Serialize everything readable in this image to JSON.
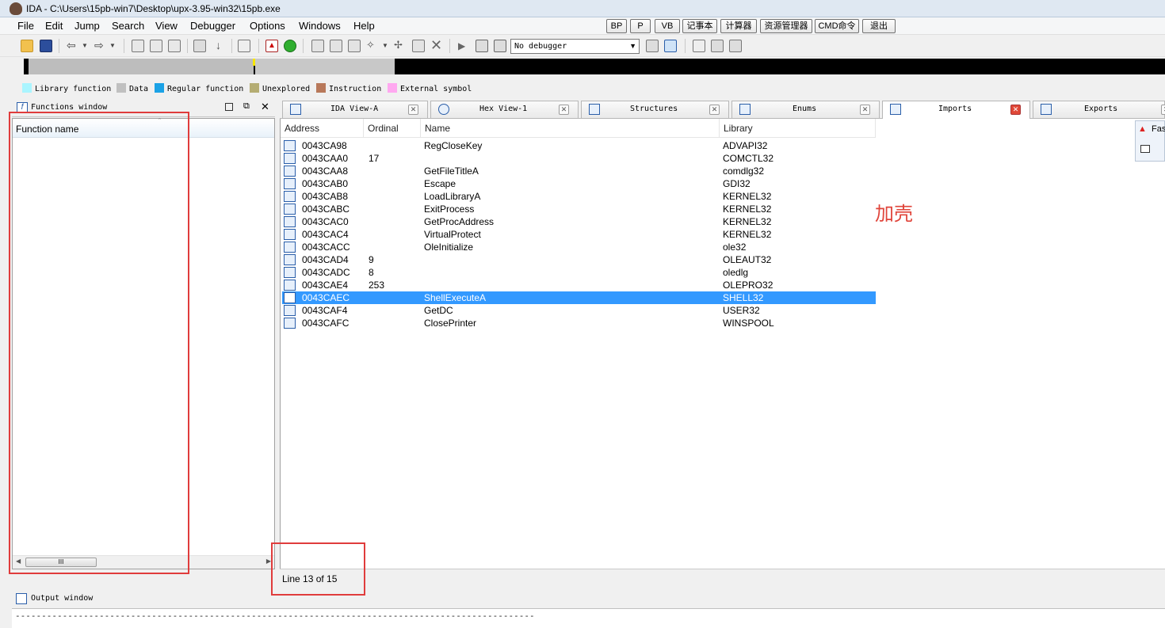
{
  "window": {
    "title": "IDA - C:\\Users\\15pb-win7\\Desktop\\upx-3.95-win32\\15pb.exe"
  },
  "menu": [
    "File",
    "Edit",
    "Jump",
    "Search",
    "View",
    "Debugger",
    "Options",
    "Windows",
    "Help"
  ],
  "quick_buttons": [
    "BP",
    "P",
    "VB",
    "记事本",
    "计算器",
    "资源管理器",
    "CMD命令",
    "退出"
  ],
  "debugger_select": {
    "value": "No debugger"
  },
  "legend": [
    {
      "label": "Library function",
      "color": "#aaf5ff"
    },
    {
      "label": "Data",
      "color": "#c0c0c0"
    },
    {
      "label": "Regular function",
      "color": "#1ba2e6"
    },
    {
      "label": "Unexplored",
      "color": "#b5ad73"
    },
    {
      "label": "Instruction",
      "color": "#b8785a"
    },
    {
      "label": "External symbol",
      "color": "#ffa8f0"
    }
  ],
  "functions_window": {
    "title": "Functions window",
    "column": "Function name",
    "scroll_grip": "III"
  },
  "tabs": [
    {
      "label": "IDA View-A"
    },
    {
      "label": "Hex View-1"
    },
    {
      "label": "Structures"
    },
    {
      "label": "Enums"
    },
    {
      "label": "Imports",
      "active": true
    },
    {
      "label": "Exports"
    }
  ],
  "imports": {
    "columns": [
      "Address",
      "Ordinal",
      "Name",
      "Library"
    ],
    "rows": [
      {
        "address": "0043CA98",
        "ordinal": "",
        "name": "RegCloseKey",
        "library": "ADVAPI32"
      },
      {
        "address": "0043CAA0",
        "ordinal": "17",
        "name": "",
        "library": "COMCTL32"
      },
      {
        "address": "0043CAA8",
        "ordinal": "",
        "name": "GetFileTitleA",
        "library": "comdlg32"
      },
      {
        "address": "0043CAB0",
        "ordinal": "",
        "name": "Escape",
        "library": "GDI32"
      },
      {
        "address": "0043CAB8",
        "ordinal": "",
        "name": "LoadLibraryA",
        "library": "KERNEL32"
      },
      {
        "address": "0043CABC",
        "ordinal": "",
        "name": "ExitProcess",
        "library": "KERNEL32"
      },
      {
        "address": "0043CAC0",
        "ordinal": "",
        "name": "GetProcAddress",
        "library": "KERNEL32"
      },
      {
        "address": "0043CAC4",
        "ordinal": "",
        "name": "VirtualProtect",
        "library": "KERNEL32"
      },
      {
        "address": "0043CACC",
        "ordinal": "",
        "name": "OleInitialize",
        "library": "ole32"
      },
      {
        "address": "0043CAD4",
        "ordinal": "9",
        "name": "",
        "library": "OLEAUT32"
      },
      {
        "address": "0043CADC",
        "ordinal": "8",
        "name": "",
        "library": "oledlg"
      },
      {
        "address": "0043CAE4",
        "ordinal": "253",
        "name": "",
        "library": "OLEPRO32"
      },
      {
        "address": "0043CAEC",
        "ordinal": "",
        "name": "ShellExecuteA",
        "library": "SHELL32",
        "selected": true
      },
      {
        "address": "0043CAF4",
        "ordinal": "",
        "name": "GetDC",
        "library": "USER32"
      },
      {
        "address": "0043CAFC",
        "ordinal": "",
        "name": "ClosePrinter",
        "library": "WINSPOOL"
      }
    ]
  },
  "status": {
    "text": "Line 13 of 15"
  },
  "output_window": {
    "title": "Output window",
    "line": "---------------------------------------------------------------------------------------------------"
  },
  "annotation": {
    "text": "加壳",
    "color": "#e0443a"
  },
  "fast_widget": {
    "label": "Fas"
  }
}
